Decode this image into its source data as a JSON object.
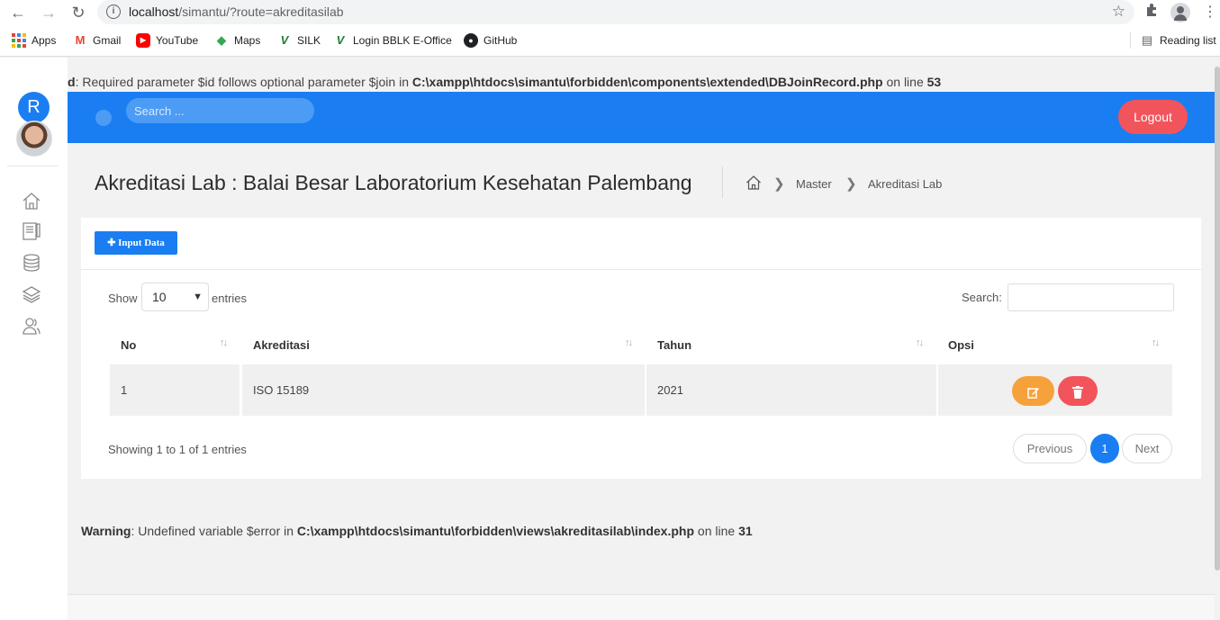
{
  "browser": {
    "url_host": "localhost",
    "url_path": "/simantu/?route=akreditasilab",
    "bookmarks": [
      {
        "label": "Apps",
        "icon": "apps-grid-icon",
        "color": "#4285f4"
      },
      {
        "label": "Gmail",
        "icon": "gmail-icon",
        "color": "#ea4335"
      },
      {
        "label": "YouTube",
        "icon": "youtube-icon",
        "color": "#ff0000"
      },
      {
        "label": "Maps",
        "icon": "maps-icon",
        "color": "#34a853"
      },
      {
        "label": "SILK",
        "icon": "silk-icon",
        "color": "#1e7e34"
      },
      {
        "label": "Login BBLK E-Office",
        "icon": "eoffice-icon",
        "color": "#1e7e34"
      },
      {
        "label": "GitHub",
        "icon": "github-icon",
        "color": "#202124"
      }
    ],
    "reading_list_label": "Reading list"
  },
  "warnings": {
    "top": {
      "prefix": "d",
      "message": ": Required parameter $id follows optional parameter $join in ",
      "path": "C:\\xampp\\htdocs\\simantu\\forbidden\\components\\extended\\DBJoinRecord.php",
      "mid": " on line ",
      "line": "53"
    },
    "bottom": {
      "label": "Warning",
      "message": ": Undefined variable $error in ",
      "path": "C:\\xampp\\htdocs\\simantu\\forbidden\\views\\akreditasilab\\index.php",
      "mid": " on line ",
      "line": "31"
    }
  },
  "sidebar": {
    "initial": "R",
    "icons": [
      "home-icon",
      "notebook-icon",
      "database-icon",
      "layers-icon",
      "users-icon"
    ]
  },
  "topbar": {
    "search_placeholder": "Search ...",
    "logout_label": "Logout",
    "accent": "#1a7ef2"
  },
  "header": {
    "title": "Akreditasi Lab : Balai Besar Laboratorium Kesehatan Palembang",
    "breadcrumb": [
      "Master",
      "Akreditasi Lab"
    ]
  },
  "card": {
    "input_button": "Input Data",
    "show_label": "Show",
    "entries_value": "10",
    "entries_label": "entries",
    "search_label": "Search:",
    "columns": [
      "No",
      "Akreditasi",
      "Tahun",
      "Opsi"
    ],
    "rows": [
      {
        "no": "1",
        "akreditasi": "ISO 15189",
        "tahun": "2021"
      }
    ],
    "info": "Showing 1 to 1 of 1 entries",
    "pagination": {
      "previous": "Previous",
      "current": "1",
      "next": "Next"
    }
  }
}
